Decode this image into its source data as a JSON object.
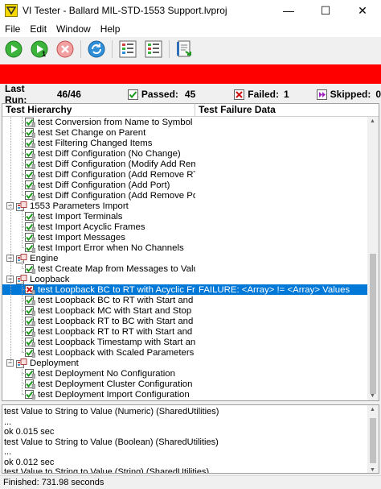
{
  "window": {
    "title": "VI Tester - Ballard MIL-STD-1553 Support.lvproj",
    "minimize": "—",
    "maximize": "☐",
    "close": "✕"
  },
  "menu": [
    "File",
    "Edit",
    "Window",
    "Help"
  ],
  "summary": {
    "last_run_label": "Last Run:",
    "last_run_value": "46/46",
    "passed_label": "Passed:",
    "passed_value": "45",
    "failed_label": "Failed:",
    "failed_value": "1",
    "skipped_label": "Skipped:",
    "skipped_value": "0"
  },
  "tree": {
    "col_hierarchy": "Test Hierarchy",
    "col_failure": "Test Failure Data",
    "rows": [
      {
        "type": "test",
        "status": "pass",
        "label": "test Conversion from Name to Symbol",
        "failure": ""
      },
      {
        "type": "test",
        "status": "pass",
        "label": "test Set Change on Parent",
        "failure": ""
      },
      {
        "type": "test",
        "status": "pass",
        "label": "test Filtering Changed Items",
        "failure": ""
      },
      {
        "type": "test",
        "status": "pass",
        "label": "test Diff Configuration (No Change)",
        "failure": ""
      },
      {
        "type": "test",
        "status": "pass",
        "label": "test Diff Configuration (Modify Add Remove)",
        "failure": ""
      },
      {
        "type": "test",
        "status": "pass",
        "label": "test Diff Configuration (Add Remove RTs)",
        "failure": ""
      },
      {
        "type": "test",
        "status": "pass",
        "label": "test Diff Configuration (Add Port)",
        "failure": ""
      },
      {
        "type": "test",
        "status": "pass",
        "label": "test Diff Configuration (Add Remove Ports and",
        "failure": ""
      },
      {
        "type": "group",
        "status": "",
        "label": "1553 Parameters Import",
        "failure": ""
      },
      {
        "type": "test",
        "status": "pass",
        "label": "test Import Terminals",
        "failure": ""
      },
      {
        "type": "test",
        "status": "pass",
        "label": "test Import Acyclic Frames",
        "failure": ""
      },
      {
        "type": "test",
        "status": "pass",
        "label": "test Import Messages",
        "failure": ""
      },
      {
        "type": "test",
        "status": "pass",
        "label": "test Import Error when No Channels",
        "failure": ""
      },
      {
        "type": "group",
        "status": "",
        "label": "Engine",
        "failure": ""
      },
      {
        "type": "test",
        "status": "pass",
        "label": "test Create Map from Messages to Value Index",
        "failure": ""
      },
      {
        "type": "group",
        "status": "",
        "label": "Loopback",
        "failure": ""
      },
      {
        "type": "test",
        "status": "fail",
        "label": "test Loopback BC to RT with Acyclic Frame",
        "failure": "FAILURE: <Array> != <Array> Values"
      },
      {
        "type": "test",
        "status": "pass",
        "label": "test Loopback BC to RT with Start and Stop",
        "failure": ""
      },
      {
        "type": "test",
        "status": "pass",
        "label": "test Loopback MC with Start and Stop",
        "failure": ""
      },
      {
        "type": "test",
        "status": "pass",
        "label": "test Loopback RT to BC with Start and Stop",
        "failure": ""
      },
      {
        "type": "test",
        "status": "pass",
        "label": "test Loopback RT to RT with Start and Stop",
        "failure": ""
      },
      {
        "type": "test",
        "status": "pass",
        "label": "test Loopback Timestamp with Start and Stop",
        "failure": ""
      },
      {
        "type": "test",
        "status": "pass",
        "label": "test Loopback with Scaled Parameters",
        "failure": ""
      },
      {
        "type": "group",
        "status": "",
        "label": "Deployment",
        "failure": ""
      },
      {
        "type": "test",
        "status": "pass",
        "label": "test Deployment No Configuration",
        "failure": ""
      },
      {
        "type": "test",
        "status": "pass",
        "label": "test Deployment Cluster Configuration",
        "failure": ""
      },
      {
        "type": "test",
        "status": "pass",
        "label": "test Deployment Import Configuration",
        "failure": ""
      }
    ]
  },
  "log": [
    "test Value to String to Value (Numeric) (SharedUtilities)",
    "...",
    "ok 0.015 sec",
    "test Value to String to Value (Boolean) (SharedUtilities)",
    "...",
    "ok 0.012 sec",
    "test Value to String to Value (String) (SharedUtilities)"
  ],
  "footer": "Finished: 731.98 seconds",
  "colors": {
    "status_bar": "#ff0000",
    "selection": "#0078d7",
    "pass_green": "#1a9a1a",
    "fail_red": "#d01010"
  }
}
